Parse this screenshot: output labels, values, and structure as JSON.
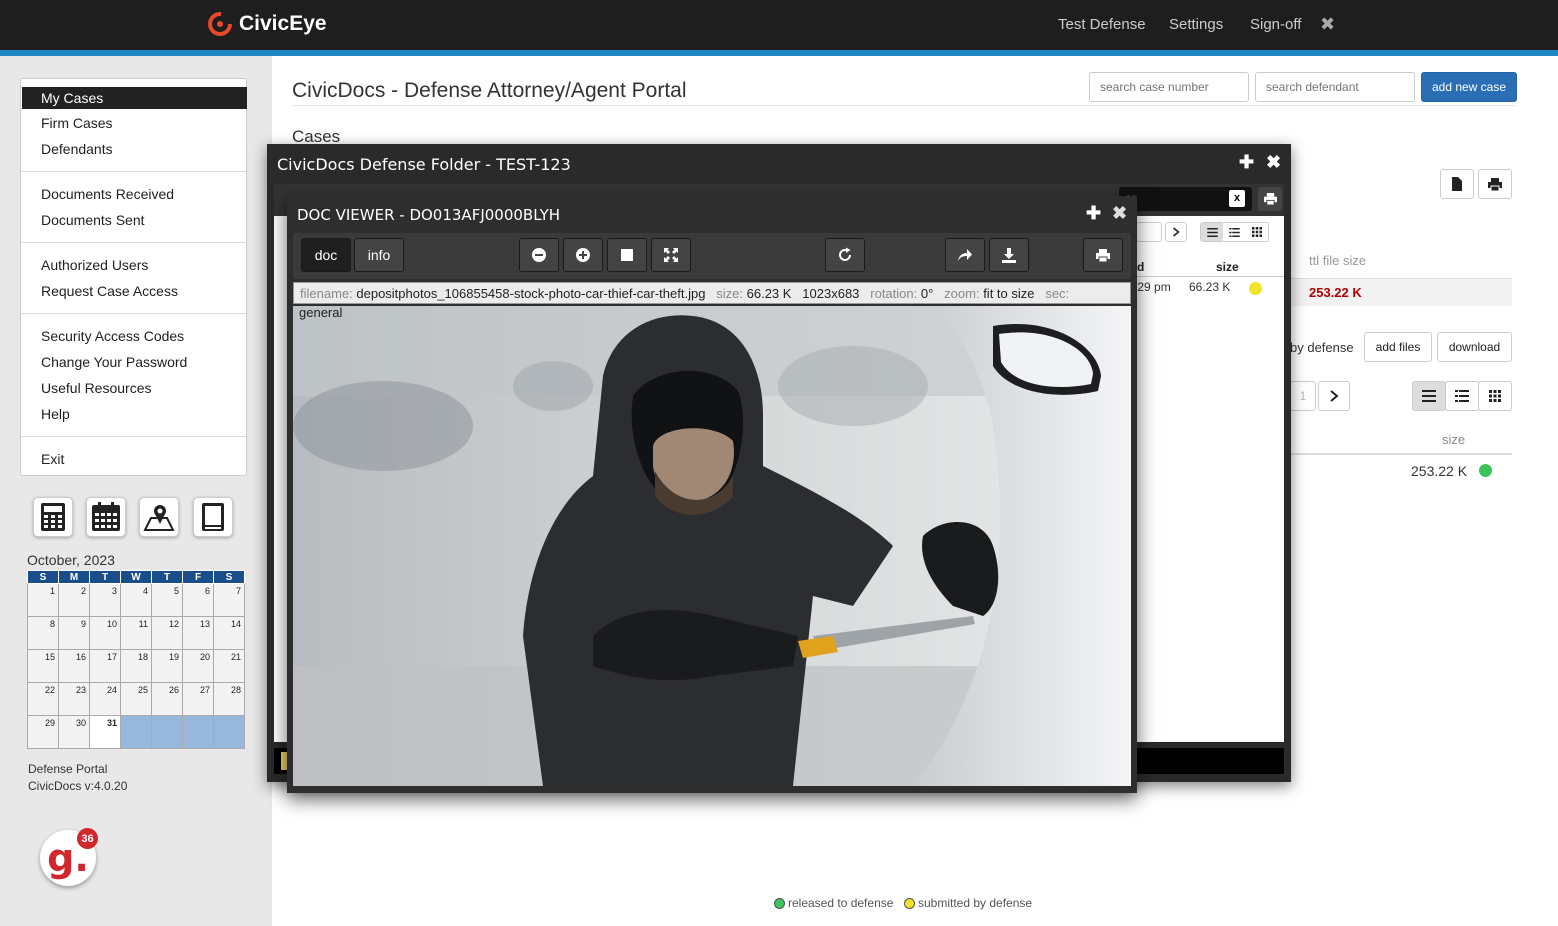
{
  "header": {
    "brand": "CivicEye",
    "nav": [
      "Test Defense",
      "Settings",
      "Sign-off"
    ],
    "close_glyph": "✖"
  },
  "menu": {
    "groups": [
      [
        "My Cases",
        "Firm Cases",
        "Defendants"
      ],
      [
        "Documents Received",
        "Documents Sent"
      ],
      [
        "Authorized Users",
        "Request Case Access"
      ],
      [
        "Security Access Codes",
        "Change Your Password",
        "Useful Resources",
        "Help"
      ],
      [
        "Exit"
      ]
    ],
    "active": "My Cases"
  },
  "tools": [
    "calculator-icon",
    "calendar-icon",
    "map-icon",
    "book-icon"
  ],
  "calendar": {
    "month": "October, 2023",
    "days": [
      "S",
      "M",
      "T",
      "W",
      "T",
      "F",
      "S"
    ],
    "today": 31,
    "weeks": [
      [
        "1",
        "2",
        "3",
        "4",
        "5",
        "6",
        "7"
      ],
      [
        "8",
        "9",
        "10",
        "11",
        "12",
        "13",
        "14"
      ],
      [
        "15",
        "16",
        "17",
        "18",
        "19",
        "20",
        "21"
      ],
      [
        "22",
        "23",
        "24",
        "25",
        "26",
        "27",
        "28"
      ],
      [
        "29",
        "30",
        "31",
        "",
        "",
        "",
        ""
      ]
    ]
  },
  "footer": {
    "portal": "Defense Portal",
    "version": "CivicDocs v:4.0.20",
    "badge_letter": "g.",
    "badge_count": "36"
  },
  "main": {
    "title": "CivicDocs - Defense Attorney/Agent Portal",
    "section": "Cases",
    "search_case_placeholder": "search case number",
    "search_def_placeholder": "search defendant",
    "add_case": "add new case",
    "ttl_label": "ttl file size",
    "ttl_value": "253.22 K",
    "by_defense": "by defense",
    "add_files": "add files",
    "download": "download",
    "size_label": "size",
    "size_value": "253.22 K",
    "page_val": "1"
  },
  "legend": {
    "released": "released to defense",
    "submitted": "submitted by defense",
    "released_color": "#3cc35a",
    "submitted_color": "#f0e427"
  },
  "folder": {
    "title": "CivicDocs Defense Folder - TEST-123",
    "filter_text": "er",
    "filter_clear": "x",
    "time": ":29 pm",
    "size_hdr": "size",
    "d_hdr": "d",
    "size": "66.23 K"
  },
  "viewer": {
    "title": "DOC VIEWER - DO013AFJ0000BLYH",
    "tabs": [
      "doc",
      "info"
    ],
    "filename_label": "filename:",
    "filename": "depositphotos_106855458-stock-photo-car-thief-car-theft.jpg",
    "size_label": "size:",
    "size": "66.23 K",
    "dims": "1023x683",
    "rotation_label": "rotation:",
    "rotation": "0°",
    "zoom_label": "zoom:",
    "zoom": "fit to size",
    "sec_label": "sec:",
    "sec": "general"
  }
}
